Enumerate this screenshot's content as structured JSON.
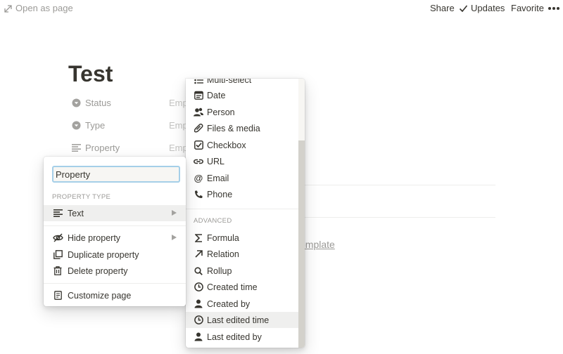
{
  "topbar": {
    "open_as_page": "Open as page",
    "share": "Share",
    "updates": "Updates",
    "favorite": "Favorite"
  },
  "page": {
    "title": "Test",
    "properties": [
      {
        "label": "Status",
        "value": "Emp",
        "icon": "select-icon"
      },
      {
        "label": "Type",
        "value": "Emp",
        "icon": "select-icon"
      },
      {
        "label": "Property",
        "value": "Emp",
        "icon": "text-lines-icon"
      }
    ],
    "template_link": "emplate"
  },
  "property_menu": {
    "name_value": "Property",
    "type_section_label": "PROPERTY TYPE",
    "type_value": "Text",
    "items": [
      {
        "label": "Hide property",
        "icon": "eye-slash-icon"
      },
      {
        "label": "Duplicate property",
        "icon": "duplicate-icon"
      },
      {
        "label": "Delete property",
        "icon": "trash-icon"
      },
      {
        "label": "Customize page",
        "icon": "page-icon"
      }
    ]
  },
  "type_menu": {
    "basic_items": [
      {
        "label": "Multi-select",
        "icon": "list-icon"
      },
      {
        "label": "Date",
        "icon": "calendar-icon"
      },
      {
        "label": "Person",
        "icon": "people-icon"
      },
      {
        "label": "Files & media",
        "icon": "paperclip-icon"
      },
      {
        "label": "Checkbox",
        "icon": "checkbox-icon"
      },
      {
        "label": "URL",
        "icon": "link-icon"
      },
      {
        "label": "Email",
        "icon": "at-icon"
      },
      {
        "label": "Phone",
        "icon": "phone-icon"
      }
    ],
    "advanced_label": "ADVANCED",
    "advanced_items": [
      {
        "label": "Formula",
        "icon": "sigma-icon"
      },
      {
        "label": "Relation",
        "icon": "arrow-up-right-icon"
      },
      {
        "label": "Rollup",
        "icon": "search-icon"
      },
      {
        "label": "Created time",
        "icon": "clock-icon"
      },
      {
        "label": "Created by",
        "icon": "person-icon"
      },
      {
        "label": "Last edited time",
        "icon": "clock-icon"
      },
      {
        "label": "Last edited by",
        "icon": "person-icon"
      }
    ]
  }
}
